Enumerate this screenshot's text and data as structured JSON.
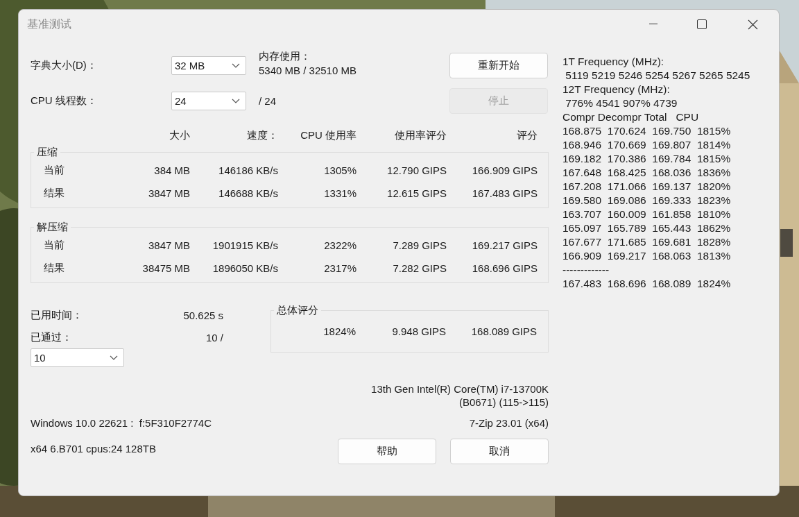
{
  "window": {
    "title": "基准测试"
  },
  "settings": [
    {
      "label": "字典大小(D)：",
      "value": "32 MB"
    },
    {
      "label": "CPU 线程数：",
      "value": "24"
    }
  ],
  "memory": {
    "label": "内存使用：",
    "value": "5340 MB / 32510 MB"
  },
  "threads_total": "/ 24",
  "buttons": [
    {
      "label": "重新开始",
      "disabled": false
    },
    {
      "label": "停止",
      "disabled": true
    }
  ],
  "table": {
    "columns": [
      "大小",
      "速度：",
      "CPU 使用率",
      "使用率评分",
      "评分"
    ],
    "groups": [
      {
        "title": "压缩",
        "rows": [
          {
            "name": "当前",
            "cells": [
              "384 MB",
              "146186 KB/s",
              "1305%",
              "12.790 GIPS",
              "166.909 GIPS"
            ]
          },
          {
            "name": "结果",
            "cells": [
              "3847 MB",
              "146688 KB/s",
              "1331%",
              "12.615 GIPS",
              "167.483 GIPS"
            ]
          }
        ]
      },
      {
        "title": "解压缩",
        "rows": [
          {
            "name": "当前",
            "cells": [
              "3847 MB",
              "1901915 KB/s",
              "2322%",
              "7.289 GIPS",
              "169.217 GIPS"
            ]
          },
          {
            "name": "结果",
            "cells": [
              "38475 MB",
              "1896050 KB/s",
              "2317%",
              "7.282 GIPS",
              "168.696 GIPS"
            ]
          }
        ]
      }
    ]
  },
  "elapsed": {
    "label": "已用时间：",
    "value": "50.625 s"
  },
  "passes": {
    "label": "已通过：",
    "value": "10 /",
    "select": "10"
  },
  "total": {
    "title": "总体评分",
    "cells": [
      "1824%",
      "9.948 GIPS",
      "168.089 GIPS"
    ]
  },
  "cpu_info": [
    "13th Gen Intel(R) Core(TM) i7-13700K",
    "(B0671) (115->115)"
  ],
  "os_info": "Windows 10.0 22621 :  f:5F310F2774C",
  "version": "7-Zip 23.01 (x64)",
  "system_info": "x64 6.B701 cpus:24 128TB",
  "footer_buttons": [
    "帮助",
    "取消"
  ],
  "log_lines": [
    "1T Frequency (MHz):",
    " 5119 5219 5246 5254 5267 5265 5245",
    "12T Frequency (MHz):",
    " 776% 4541 907% 4739",
    "Compr Decompr Total   CPU",
    "168.875  170.624  169.750  1815%",
    "168.946  170.669  169.807  1814%",
    "169.182  170.386  169.784  1815%",
    "167.648  168.425  168.036  1836%",
    "167.208  171.066  169.137  1820%",
    "169.580  169.086  169.333  1823%",
    "163.707  160.009  161.858  1810%",
    "165.097  165.789  165.443  1862%",
    "167.677  171.685  169.681  1828%",
    "166.909  169.217  168.063  1813%",
    "-------------",
    "167.483  168.696  168.089  1824%"
  ]
}
